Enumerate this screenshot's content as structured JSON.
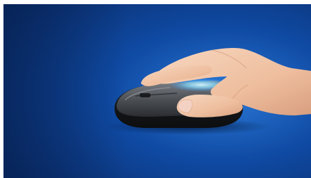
{
  "image": {
    "subject": "hand-resting-on-wireless-mouse",
    "icon_names": [
      "mouse-icon",
      "hand-icon",
      "glow-ring-icon"
    ],
    "colors": {
      "background_dark": "#0b2e6e",
      "background_mid": "#0f4aa3",
      "background_light": "#1f66c7",
      "mouse_body": "#2b2d31",
      "mouse_top": "#5e6166",
      "glow": "#9fe6ff",
      "skin": "#f2c9ad"
    }
  }
}
